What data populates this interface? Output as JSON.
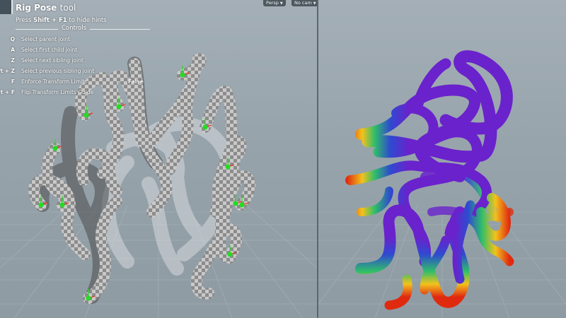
{
  "tool": {
    "title_bold": "Rig Pose",
    "title_rest": "tool",
    "hint_prefix": "Press",
    "hint_keys": "Shift + F1",
    "hint_suffix": "to hide hints",
    "controls_title": "Controls"
  },
  "controls": [
    {
      "key": "Q",
      "label": "Select parent joint",
      "value": ""
    },
    {
      "key": "A",
      "label": "Select first child joint",
      "value": ""
    },
    {
      "key": "Z",
      "label": "Select next sibling joint",
      "value": ""
    },
    {
      "key": "ft + Z",
      "label": "Select previous sibling joint",
      "value": ""
    },
    {
      "key": "F",
      "label": "Enforce Transform Limits",
      "value": "False"
    },
    {
      "key": "t + F",
      "label": "Flip Transform Limits Guide",
      "value": ""
    }
  ],
  "viewport_menu": {
    "camera_mode": "Persp",
    "camera": "No cam"
  },
  "colors": {
    "viewport_bg": "#9aa6ae",
    "joint_green": "#22dd22",
    "heat_purple": "#6a22cc",
    "heat_red": "#e02a10"
  },
  "icons": {
    "tool_icon": "rig-pose-icon",
    "dropdown": "chevron-down-icon"
  }
}
